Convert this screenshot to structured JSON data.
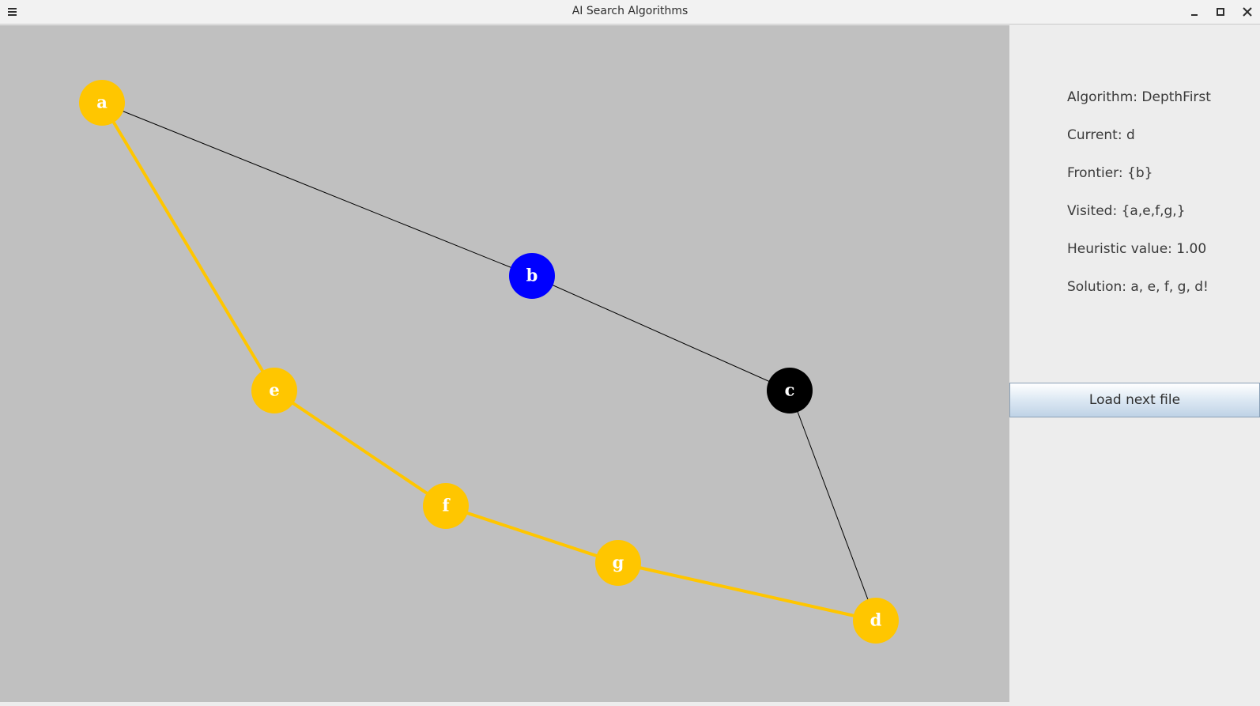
{
  "window": {
    "title": "AI Search Algorithms",
    "menu_icon": "hamburger-menu-icon",
    "buttons": [
      "minimize-icon",
      "maximize-icon",
      "close-icon"
    ]
  },
  "colors": {
    "canvas_bg": "#c0c0c0",
    "visited_node": "#ffc600",
    "frontier_node": "#0000ff",
    "unvisited_node": "#000000",
    "solution_edge": "#ffc600",
    "plain_edge": "#000000",
    "node_label": "#ffffff"
  },
  "graph": {
    "nodes": [
      {
        "id": "a",
        "label": "a",
        "state": "visited"
      },
      {
        "id": "b",
        "label": "b",
        "state": "frontier"
      },
      {
        "id": "c",
        "label": "c",
        "state": "unvisited"
      },
      {
        "id": "d",
        "label": "d",
        "state": "visited"
      },
      {
        "id": "e",
        "label": "e",
        "state": "visited"
      },
      {
        "id": "f",
        "label": "f",
        "state": "visited"
      },
      {
        "id": "g",
        "label": "g",
        "state": "visited"
      }
    ],
    "edges": [
      {
        "from": "a",
        "to": "b",
        "solution": false
      },
      {
        "from": "b",
        "to": "c",
        "solution": false
      },
      {
        "from": "c",
        "to": "d",
        "solution": false
      },
      {
        "from": "a",
        "to": "e",
        "solution": true
      },
      {
        "from": "e",
        "to": "f",
        "solution": true
      },
      {
        "from": "f",
        "to": "g",
        "solution": true
      },
      {
        "from": "g",
        "to": "d",
        "solution": true
      }
    ]
  },
  "panel": {
    "algorithm": "Algorithm: DepthFirst",
    "current": "Current: d",
    "frontier": "Frontier: {b}",
    "visited": "Visited: {a,e,f,g,}",
    "heuristic": "Heuristic value: 1.00",
    "solution": "Solution: a, e, f, g, d!",
    "load_button": "Load next file"
  }
}
